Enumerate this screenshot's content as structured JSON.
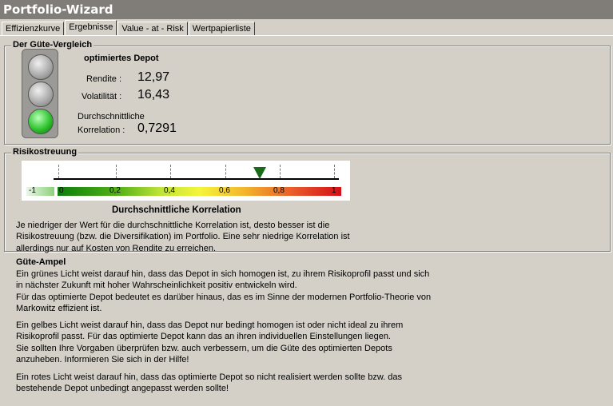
{
  "window": {
    "title": "Portfolio-Wizard"
  },
  "tabs": [
    {
      "label": "Effizienzkurve"
    },
    {
      "label": "Ergebnisse",
      "active": true
    },
    {
      "label": "Value - at - Risk"
    },
    {
      "label": "Wertpapierliste"
    }
  ],
  "guete": {
    "title": "Der Güte-Vergleich",
    "depot_label": "optimiertes Depot",
    "rendite_label": "Rendite :",
    "rendite_value": "12,97",
    "volatilitaet_label": "Volatilität :",
    "volatilitaet_value": "16,43",
    "korrelation_label_1": "Durchschnittliche",
    "korrelation_label_2": "Korrelation :",
    "korrelation_value": "0,7291",
    "ampel_state": "green"
  },
  "risiko": {
    "title": "Risikostreuung",
    "scale_caption": "Durchschnittliche Korrelation",
    "scale_labels": [
      "-1",
      "0",
      "0,2",
      "0,4",
      "0,6",
      "0,8",
      "1"
    ],
    "marker_value": 0.7291,
    "description": [
      "Je niedriger der Wert für die durchschnittliche Korrelation ist, desto besser ist die",
      "Risikostreuung (bzw. die Diversifikation) im Portfolio. Eine sehr niedrige Korrelation ist",
      "allerdings nur auf Kosten von Rendite zu erreichen."
    ]
  },
  "ampel": {
    "title": "Güte-Ampel",
    "green_text": [
      "Ein grünes Licht weist darauf hin, dass das Depot in sich homogen ist, zu ihrem Risikoprofil passt und sich",
      "in nächster Zukunft mit hoher Wahrscheinlichkeit positiv entwickeln wird.",
      "Für das optimierte Depot bedeutet es darüber hinaus, das es im Sinne der modernen Portfolio-Theorie von",
      "Markowitz effizient ist."
    ],
    "yellow_text": [
      "Ein gelbes Licht weist darauf hin, dass das Depot nur bedingt homogen ist oder nicht ideal zu ihrem",
      "Risikoprofil passt. Für das optimierte Depot kann das an ihren individuellen Einstellungen liegen.",
      "Sie sollten Ihre Vorgaben überprüfen bzw. auch verbessern, um die Güte des optimierten Depots",
      "anzuheben. Informieren Sie sich in der Hilfe!"
    ],
    "red_text": [
      "Ein rotes Licht weist darauf hin, dass das optimierte Depot so nicht realisiert werden sollte bzw. das",
      "bestehende Depot unbedingt angepasst werden sollte!"
    ]
  }
}
